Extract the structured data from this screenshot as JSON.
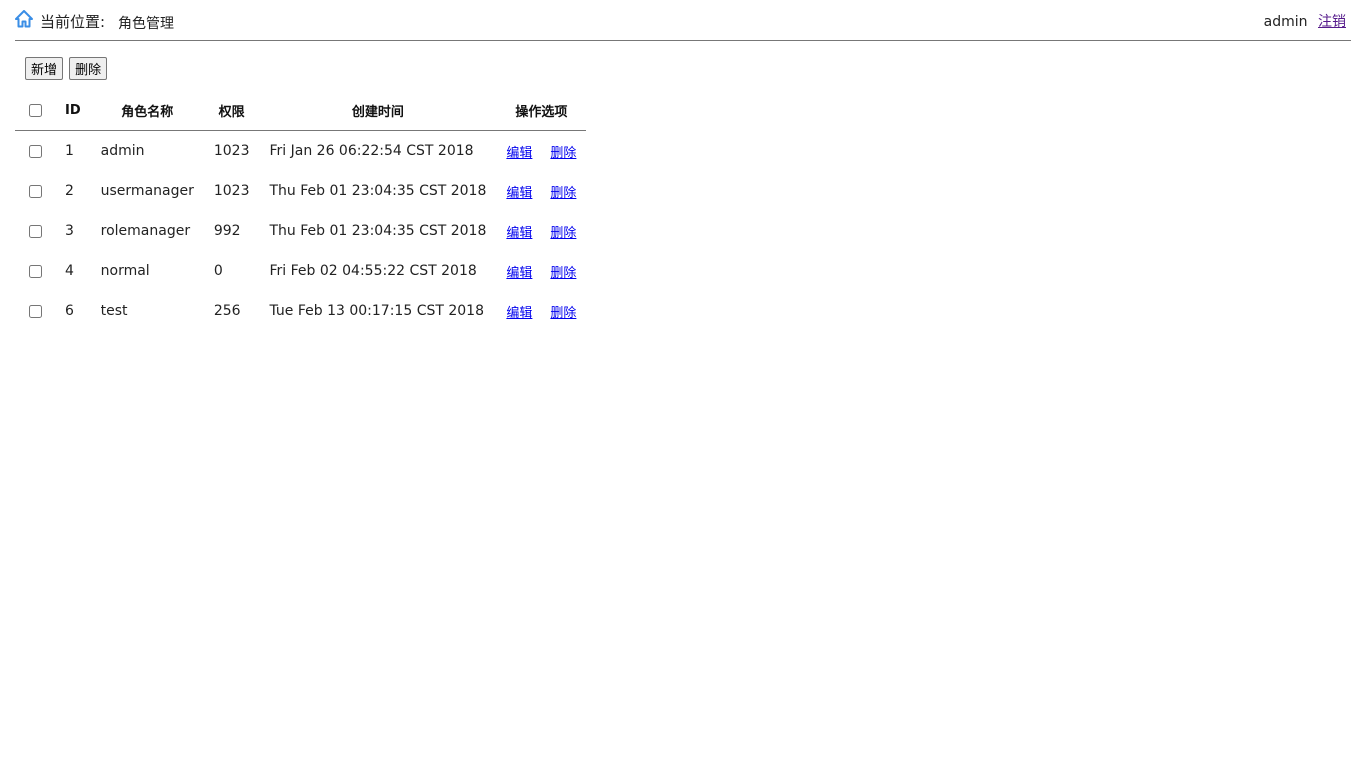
{
  "header": {
    "location_label": "当前位置:",
    "location_value": "角色管理",
    "username": "admin",
    "logout_label": "注销",
    "icon": "home-icon"
  },
  "toolbar": {
    "add_label": "新增",
    "delete_label": "删除"
  },
  "table": {
    "columns": [
      "ID",
      "角色名称",
      "权限",
      "创建时间",
      "操作选项"
    ],
    "rows": [
      {
        "id": "1",
        "name": "admin",
        "perm": "1023",
        "created": "Fri Jan 26 06:22:54 CST 2018",
        "edit": "编辑",
        "delete": "删除"
      },
      {
        "id": "2",
        "name": "usermanager",
        "perm": "1023",
        "created": "Thu Feb 01 23:04:35 CST 2018",
        "edit": "编辑",
        "delete": "删除"
      },
      {
        "id": "3",
        "name": "rolemanager",
        "perm": "992",
        "created": "Thu Feb 01 23:04:35 CST 2018",
        "edit": "编辑",
        "delete": "删除"
      },
      {
        "id": "4",
        "name": "normal",
        "perm": "0",
        "created": "Fri Feb 02 04:55:22 CST 2018",
        "edit": "编辑",
        "delete": "删除"
      },
      {
        "id": "6",
        "name": "test",
        "perm": "256",
        "created": "Tue Feb 13 00:17:15 CST 2018",
        "edit": "编辑",
        "delete": "删除"
      }
    ]
  },
  "colors": {
    "link": "#0000ee",
    "visited_link": "#551a8b",
    "home_icon": "#3a8ee6"
  }
}
